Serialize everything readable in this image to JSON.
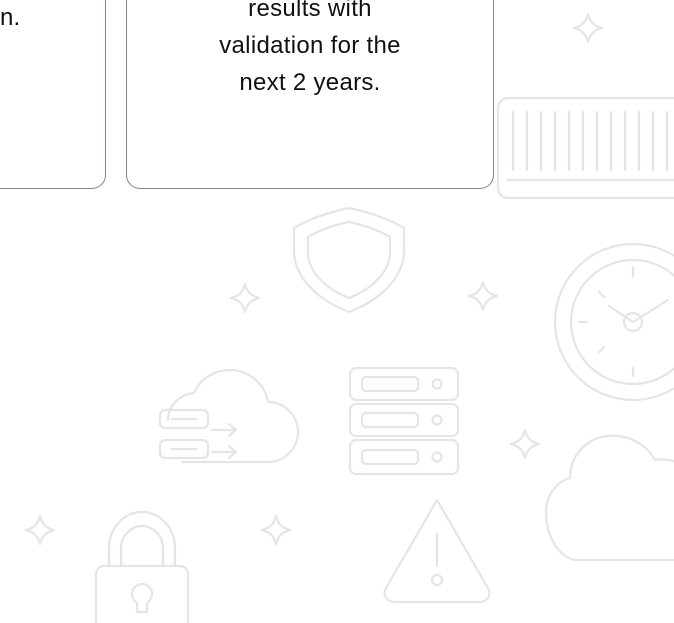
{
  "left_card": {
    "text_fragment": "n."
  },
  "right_card": {
    "lines": [
      "results with",
      "validation for the",
      "next 2 years."
    ]
  },
  "decorations": {
    "icons": [
      "server-rack-icon",
      "shield-icon",
      "clock-icon",
      "database-server-icon",
      "cloud-transfer-icon",
      "cloud-icon",
      "padlock-icon",
      "warning-icon",
      "sparkle-icon"
    ],
    "stroke_color": "#e3e5e8"
  }
}
